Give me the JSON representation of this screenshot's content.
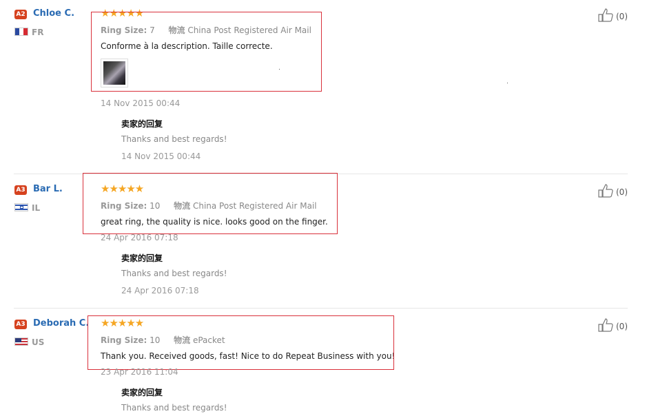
{
  "labels": {
    "ring_size_key": "Ring Size:",
    "shipping_key": "物流",
    "seller_reply_title": "卖家的回复",
    "like_icon_name": "thumbs-up-icon"
  },
  "reviews": [
    {
      "badge": "A2",
      "name": "Chloe C.",
      "country": "FR",
      "flag": "france",
      "stars": "★★★★★",
      "ring_size": "7",
      "shipping": "China Post Registered Air Mail",
      "comment": "Conforme à la description. Taille correcte.",
      "has_photo": true,
      "date": "14 Nov 2015 00:44",
      "reply_text": "Thanks and best regards!",
      "reply_date": "14 Nov 2015 00:44",
      "likes": "(0)"
    },
    {
      "badge": "A3",
      "name": "Bar L.",
      "country": "IL",
      "flag": "israel",
      "stars": "★★★★★",
      "ring_size": "10",
      "shipping": "China Post Registered Air Mail",
      "comment": "great ring, the quality is nice. looks good on the finger.",
      "has_photo": false,
      "date": "24 Apr 2016 07:18",
      "reply_text": "Thanks and best regards!",
      "reply_date": "24 Apr 2016 07:18",
      "likes": "(0)"
    },
    {
      "badge": "A3",
      "name": "Deborah C.",
      "country": "US",
      "flag": "usa",
      "stars": "★★★★★",
      "ring_size": "10",
      "shipping": "ePacket",
      "comment": "Thank you. Received goods, fast! Nice to do Repeat Business with you!",
      "has_photo": false,
      "date": "23 Apr 2016 11:04",
      "reply_text": "Thanks and best regards!",
      "reply_date": "",
      "likes": "(0)"
    }
  ],
  "colors": {
    "badge": "#d6421f",
    "name": "#2a6bb3",
    "stars": "#f5a623",
    "highlight_box": "#d9303a"
  }
}
